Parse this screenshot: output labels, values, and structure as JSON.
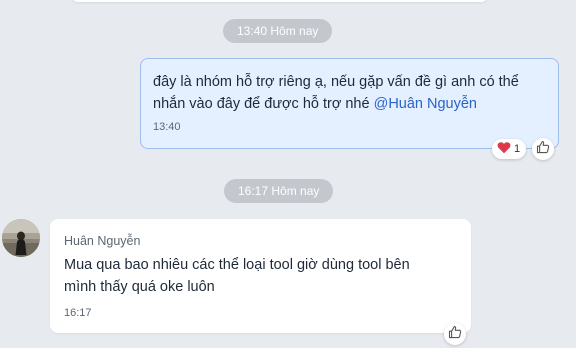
{
  "conversation": {
    "divider_1": "13:40 Hôm nay",
    "divider_2": "16:17 Hôm nay"
  },
  "message_out": {
    "text_line_1": "đây là nhóm hỗ trợ riêng ạ, nếu gặp vấn đề gì anh có thể",
    "text_line_2": "nhắn vào đây để được hỗ trợ nhé ",
    "mention": "@Huân Nguyễn",
    "time": "13:40",
    "reaction_count": "1",
    "reaction_icon": "heart-icon"
  },
  "message_in": {
    "sender": "Huân Nguyễn",
    "text_line_1": "Mua qua bao nhiêu các thể loại tool giờ dùng tool bên",
    "text_line_2": "mình thấy quá oke luôn",
    "time": "16:17"
  },
  "colors": {
    "background": "#e7eaee",
    "outgoing_bubble": "#e4efff",
    "outgoing_border": "#9dbff0",
    "mention": "#2a63c8",
    "divider_pill": "#c4c8ce",
    "heart": "#e0364a"
  }
}
